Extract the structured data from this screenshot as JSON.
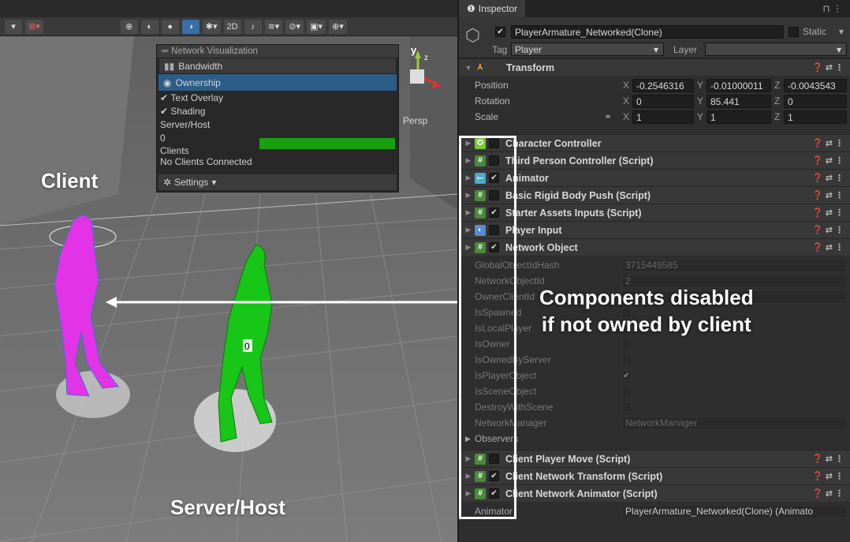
{
  "scene": {
    "toolbar": {
      "btn_2d": "2D"
    },
    "overlay": {
      "title": "Network Visualization",
      "bandwidth": "Bandwidth",
      "ownership": "Ownership",
      "text_overlay": "Text Overlay",
      "shading": "Shading",
      "server_host": "Server/Host",
      "server_value": "0",
      "clients": "Clients",
      "no_clients": "No Clients Connected",
      "settings": "Settings"
    },
    "persp": "Persp",
    "gizmo_y": "y",
    "gizmo_z": "z",
    "avatar_label": "0",
    "label_client": "Client",
    "label_server": "Server/Host",
    "colors": {
      "client": "#e233e6",
      "server": "#17c617",
      "accent": "#2c5d87"
    }
  },
  "annotation": {
    "line1": "Components disabled",
    "line2": "if not owned by client"
  },
  "inspector": {
    "tab": "Inspector",
    "object_name": "PlayerArmature_Networked(Clone)",
    "static_label": "Static",
    "tag_label": "Tag",
    "tag_value": "Player",
    "layer_label": "Layer",
    "layer_value": "",
    "transform": {
      "title": "Transform",
      "position_label": "Position",
      "rotation_label": "Rotation",
      "scale_label": "Scale",
      "pos": {
        "x": "-0.2546316",
        "y": "-0.01000011",
        "z": "-0.0043543"
      },
      "rot": {
        "x": "0",
        "y": "85.441",
        "z": "0"
      },
      "scale": {
        "x": "1",
        "y": "1",
        "z": "1"
      },
      "axis_x": "X",
      "axis_y": "Y",
      "axis_z": "Z"
    },
    "components": [
      {
        "name": "Character Controller",
        "checked": false,
        "icon": "character-controller-icon"
      },
      {
        "name": "Third Person Controller (Script)",
        "checked": false,
        "icon": "script-icon"
      },
      {
        "name": "Animator",
        "checked": true,
        "icon": "animator-icon"
      },
      {
        "name": "Basic Rigid Body Push (Script)",
        "checked": false,
        "icon": "script-icon"
      },
      {
        "name": "Starter Assets Inputs (Script)",
        "checked": true,
        "icon": "script-icon"
      },
      {
        "name": "Player Input",
        "checked": false,
        "icon": "player-input-icon"
      },
      {
        "name": "Network Object",
        "checked": true,
        "icon": "script-icon"
      }
    ],
    "network_object_props": [
      {
        "label": "GlobalObjectIdHash",
        "value": "3715449585"
      },
      {
        "label": "NetworkObjectId",
        "value": "2"
      },
      {
        "label": "OwnerClientId",
        "value": ""
      },
      {
        "label": "IsSpawned",
        "value": ""
      },
      {
        "label": "IsLocalPlayer",
        "value": ""
      },
      {
        "label": "IsOwner",
        "value": ""
      },
      {
        "label": "IsOwnedByServer",
        "value": ""
      },
      {
        "label": "IsPlayerObject",
        "value": "✔"
      },
      {
        "label": "IsSceneObject",
        "value": ""
      },
      {
        "label": "DestroyWithScene",
        "value": ""
      },
      {
        "label": "NetworkManager",
        "value": "NetworkManager"
      }
    ],
    "observers": "Observers",
    "components2": [
      {
        "name": "Client Player Move (Script)",
        "checked": false
      },
      {
        "name": "Client Network Transform (Script)",
        "checked": true
      },
      {
        "name": "Client Network Animator (Script)",
        "checked": true
      }
    ],
    "animator_label": "Animator",
    "animator_value": "PlayerArmature_Networked(Clone) (Animato"
  }
}
